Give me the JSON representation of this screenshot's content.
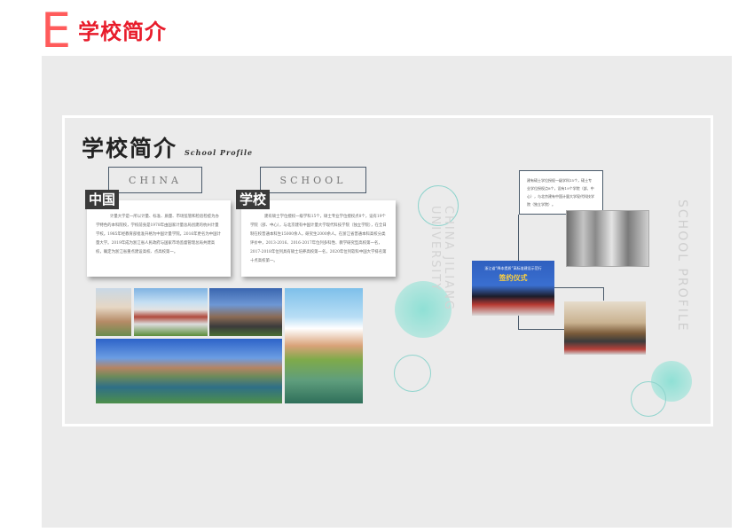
{
  "header": {
    "letter": "E",
    "title": "学校简介"
  },
  "board": {
    "title": "学校简介",
    "subtitle": "School Profile",
    "tag_china": "CHINA",
    "tag_school": "SCHOOL",
    "label_china": "中国",
    "label_school": "学校",
    "vertical_center": "CHINA JILIANG UNIVERSITY",
    "vertical_right": "SCHOOL PROFILE",
    "card1_text": "计量大学是一所以计量、标准、质量、市场监管和检验检疫为办学特色的本科院校，学校前身是1978年由国家计量总局创建的杭州计量学校。1985年经教育部批准升格为中国计量学院。2016年更名为中国计量大学。2019年成为浙江省人民政府与国家市场监督管理总局共建高校，确定为浙江省重点建设高校、点高校第一。",
    "card2_text": "建有硕士学位授权一级学科15个，硕士专业学位授权点8个，设有19个学院（部、中心），与北京建有中国计量大学现代科技学院（独立学院），在全日制在校普通本科生15000余人，研究生2000余人。在浙江省普通本科高校分类评价中，2013-2016、2016-2017年位列多科性、教学研究型高校第一名，2017-2018年位列具有硕士培养高校第一名，2020年位列软科中国大学排名第十点高校第一。",
    "rcard_text": "建有硕士学位授权一级学科15个，硕士专业学位授权点8个，设有19个学院（部、中心），与北京建有中国计量大学现代科技学院（独立学院）。",
    "banner_line1": "浙江省“降本提质”高标准建设示范行",
    "banner_line2": "签约仪式"
  },
  "colors": {
    "accent": "#e81c2b",
    "letter": "#ff5b5b",
    "panel": "#ebebeb",
    "teal": "#7fd3cc"
  }
}
